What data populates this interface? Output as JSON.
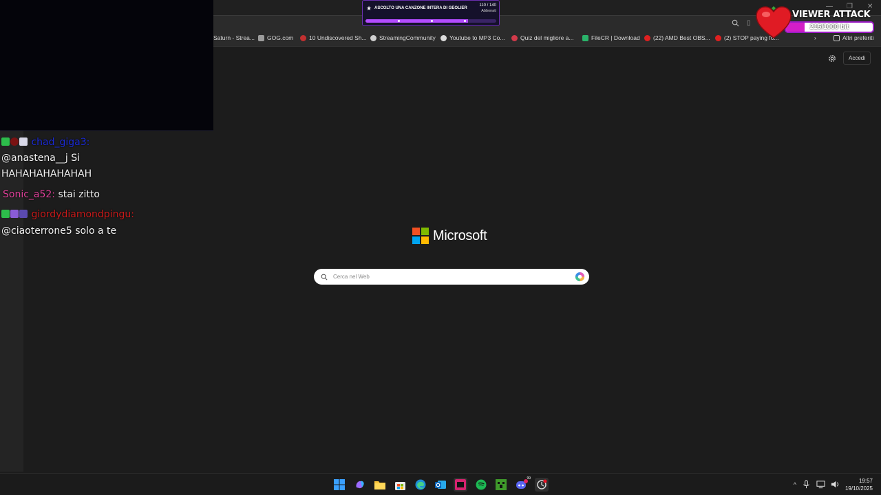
{
  "browser": {
    "search_placeholder": "Cerca nel Web",
    "signin_label": "Accedi",
    "bookmarks": [
      {
        "label": "Saturn - Strea...",
        "color": "#555555"
      },
      {
        "label": "GOG.com",
        "color": "#9c9c9c"
      },
      {
        "label": "10 Undiscovered Sh...",
        "color": "#c23030"
      },
      {
        "label": "StreamingCommunity",
        "color": "#cfcfcf"
      },
      {
        "label": "Youtube to MP3 Co...",
        "color": "#dddddd"
      },
      {
        "label": "Quiz del migliore a...",
        "color": "#d23a4a"
      },
      {
        "label": "FileCR | Download",
        "color": "#2ab36a"
      },
      {
        "label": "(22) AMD Best OBS...",
        "color": "#e02020"
      },
      {
        "label": "(2) STOP paying fo...",
        "color": "#e02020"
      }
    ],
    "other_favorites": "Altri preferiti"
  },
  "page": {
    "brand": "Microsoft",
    "brand_colors": [
      "#f25022",
      "#7fba00",
      "#00a4ef",
      "#ffb900"
    ]
  },
  "chat": {
    "messages": [
      {
        "user": "chad_giga3:",
        "user_color": "#1b2bd6",
        "text": ""
      },
      {
        "user": "",
        "user_color": "#ffffff",
        "text": "@anastena__j Si"
      },
      {
        "user": "",
        "user_color": "#ffffff",
        "text": "HAHAHAHAHAHAH"
      },
      {
        "user": "Sonic_a52:",
        "user_color": "#e0409a",
        "text": "stai zitto"
      },
      {
        "user": "giordydiamondpingu:",
        "user_color": "#c81a1a",
        "text": ""
      },
      {
        "user": "",
        "user_color": "#ffffff",
        "text": "@ciaoterrone5 solo a te"
      }
    ]
  },
  "goal": {
    "title": "ASCOLTO UNA CANZONE INTERA DI GEOLIER",
    "count": "110 / 140",
    "subtitle": "Abbonati",
    "progress": 0.786
  },
  "viewer_attack": {
    "title": "VIEWER ATTACK",
    "value": "215/1000 bit",
    "progress": 0.215
  },
  "taskbar": {
    "time": "19:57",
    "date": "19/10/2025",
    "discord_badge": "99"
  }
}
